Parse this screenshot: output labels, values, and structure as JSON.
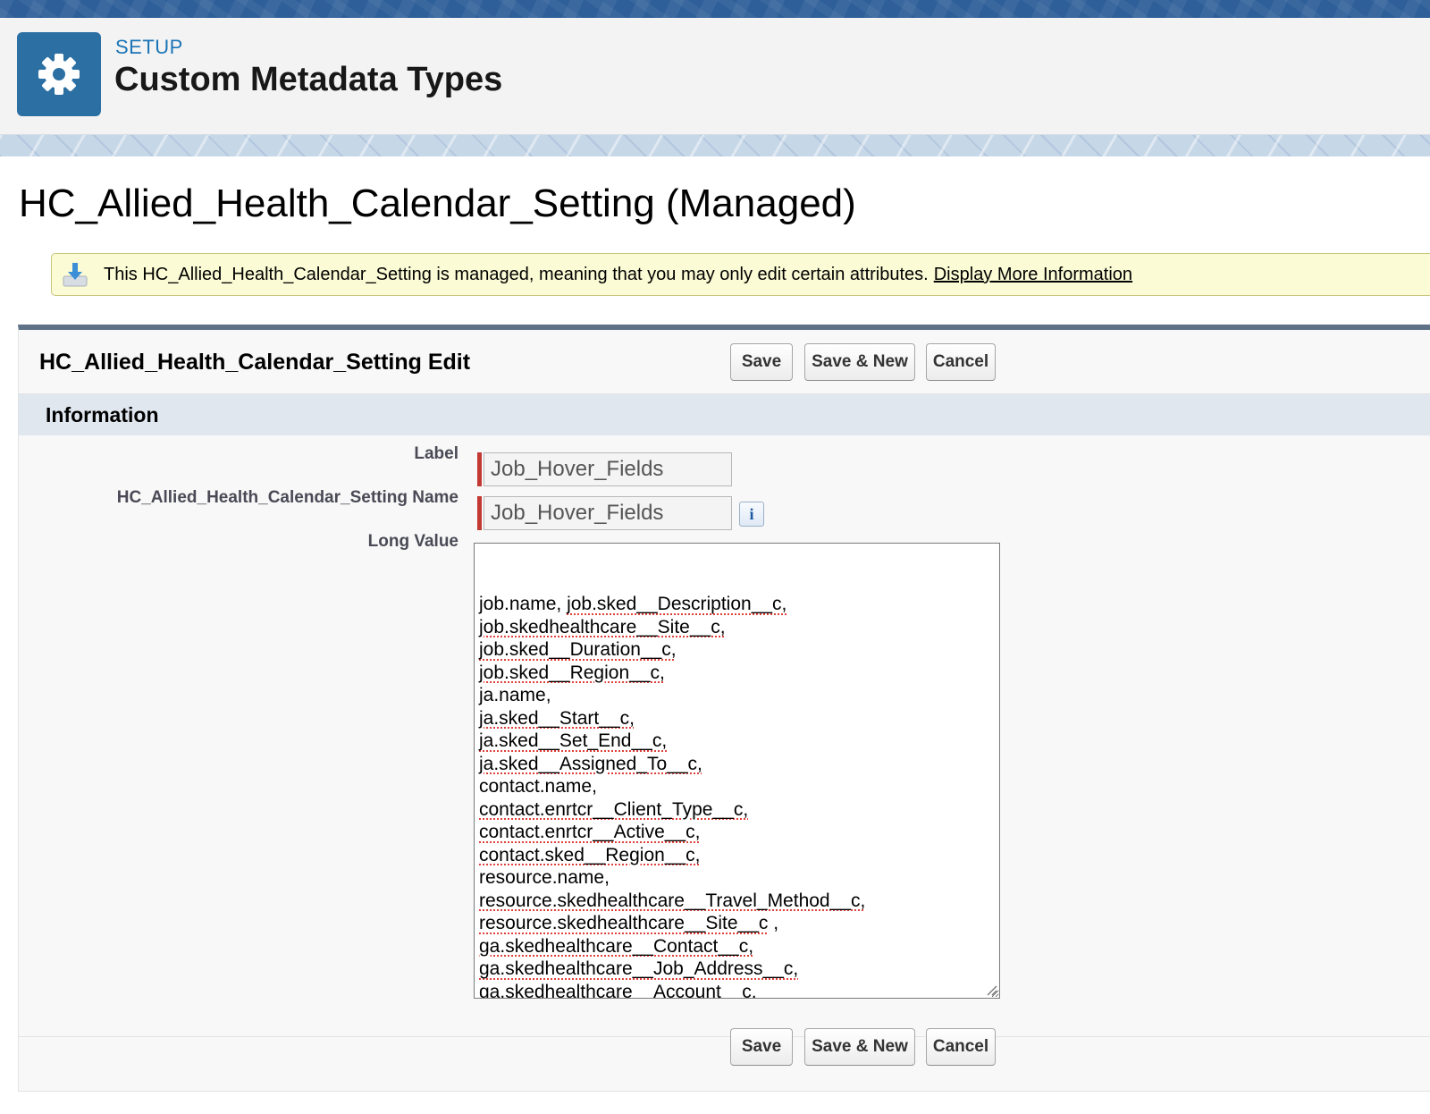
{
  "setup_header": {
    "eyebrow": "SETUP",
    "title": "Custom Metadata Types",
    "icon": "gear-icon"
  },
  "page": {
    "title": "HC_Allied_Health_Calendar_Setting (Managed)"
  },
  "notice": {
    "icon": "download-tray-icon",
    "text": "This HC_Allied_Health_Calendar_Setting is managed, meaning that you may only edit certain attributes.",
    "link": "Display More Information"
  },
  "edit_panel": {
    "title": "HC_Allied_Health_Calendar_Setting Edit",
    "buttons": {
      "save": "Save",
      "save_new": "Save & New",
      "cancel": "Cancel"
    },
    "section_title": "Information",
    "fields": {
      "label": {
        "label": "Label",
        "value": "Job_Hover_Fields",
        "required": true
      },
      "name": {
        "label": "HC_Allied_Health_Calendar_Setting Name",
        "value": "Job_Hover_Fields",
        "required": true,
        "info_icon": "info-icon"
      },
      "long_value": {
        "label": "Long Value",
        "lines": [
          "job.name, job.sked__Description__c,",
          "job.skedhealthcare__Site__c,",
          "job.sked__Duration__c,",
          "job.sked__Region__c,",
          "ja.name,",
          "ja.sked__Start__c,",
          "ja.sked__Set_End__c,",
          "ja.sked__Assigned_To__c,",
          "contact.name,",
          "contact.enrtcr__Client_Type__c,",
          "contact.enrtcr__Active__c,",
          "contact.sked__Region__c,",
          "resource.name,",
          "resource.skedhealthcare__Travel_Method__c,",
          "resource.skedhealthcare__Site__c ,",
          "ga.skedhealthcare__Contact__c,",
          "ga.skedhealthcare__Job_Address__c,",
          "ga.skedhealthcare__Account__c,"
        ]
      }
    }
  },
  "colors": {
    "brand_blue": "#2b6fa3",
    "required_red": "#c23934",
    "notice_bg": "#fbfbd5",
    "section_bg": "#e1e7ef"
  }
}
